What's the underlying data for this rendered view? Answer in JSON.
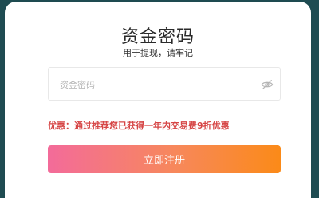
{
  "dialog": {
    "title": "资金密码",
    "subtitle": "用于提现，请牢记"
  },
  "password_field": {
    "placeholder": "资金密码",
    "value": ""
  },
  "notice": {
    "text": "优惠：通过推荐您已获得一年内交易费9折优惠"
  },
  "register_button": {
    "label": "立即注册"
  },
  "icons": {
    "visibility_toggle": "eye-off-icon"
  },
  "colors": {
    "notice": "#d64545",
    "button_gradient_start": "#f36b9a",
    "button_gradient_end": "#fb8a18",
    "background": "#1f4c52"
  }
}
